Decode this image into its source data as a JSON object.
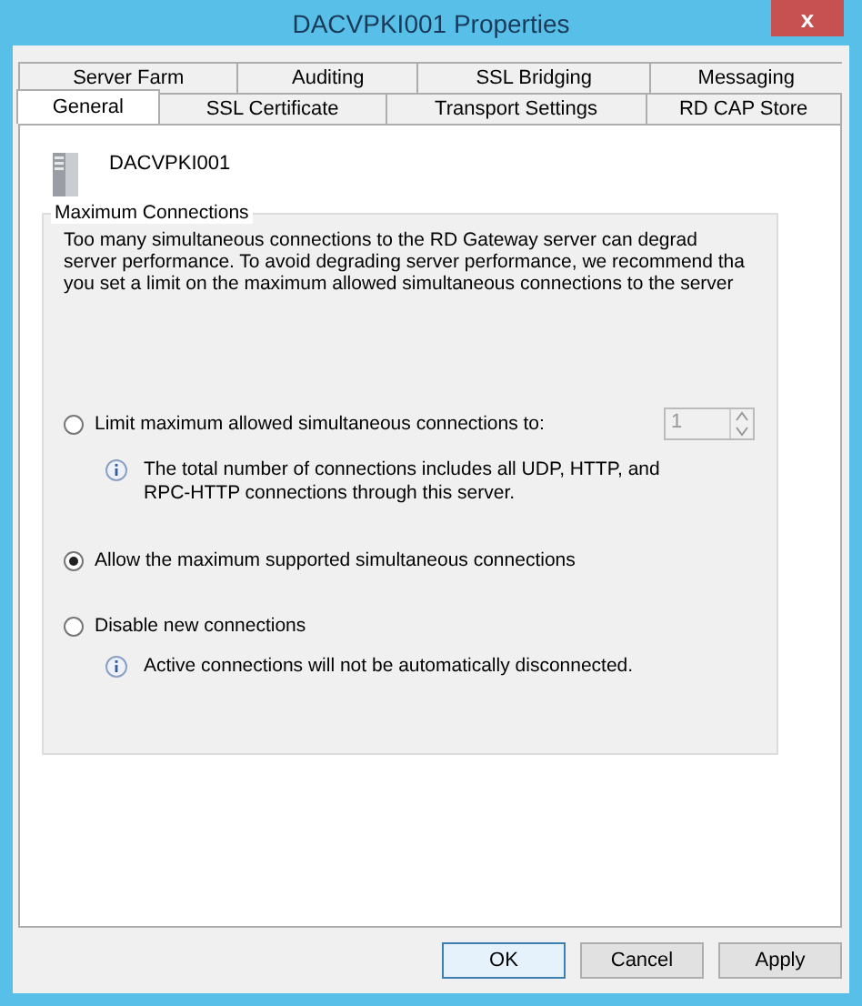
{
  "window": {
    "title": "DACVPKI001 Properties",
    "close": "x"
  },
  "tab_rows": [
    {
      "tabs": [
        {
          "label": "Server Farm",
          "selected": false
        },
        {
          "label": "Auditing",
          "selected": false
        },
        {
          "label": "SSL Bridging",
          "selected": false
        },
        {
          "label": "Messaging",
          "selected": false
        }
      ]
    },
    {
      "tabs": [
        {
          "label": "General",
          "selected": true
        },
        {
          "label": "SSL Certificate",
          "selected": false
        },
        {
          "label": "Transport Settings",
          "selected": false
        },
        {
          "label": "RD CAP Store",
          "selected": false
        }
      ]
    }
  ],
  "server": {
    "name": "DACVPKI001"
  },
  "group": {
    "title": "Maximum Connections",
    "description": [
      "Too many simultaneous connections to the RD Gateway server can degrad",
      "server performance. To avoid degrading server performance, we recommend tha",
      "you set a limit on the maximum allowed simultaneous connections to the server"
    ],
    "options": [
      {
        "label": "Limit maximum allowed simultaneous connections to:",
        "selected": false,
        "spinner": {
          "value": "1",
          "disabled": true
        },
        "note": [
          "The total number of connections includes all UDP, HTTP, and",
          "RPC-HTTP connections through this server."
        ]
      },
      {
        "label": "Allow the maximum supported simultaneous connections",
        "selected": true
      },
      {
        "label": "Disable new connections",
        "selected": false,
        "note": [
          "Active connections will not be automatically disconnected."
        ]
      }
    ]
  },
  "buttons": [
    {
      "label": "OK",
      "default": true
    },
    {
      "label": "Cancel",
      "default": false
    },
    {
      "label": "Apply",
      "default": false
    }
  ]
}
